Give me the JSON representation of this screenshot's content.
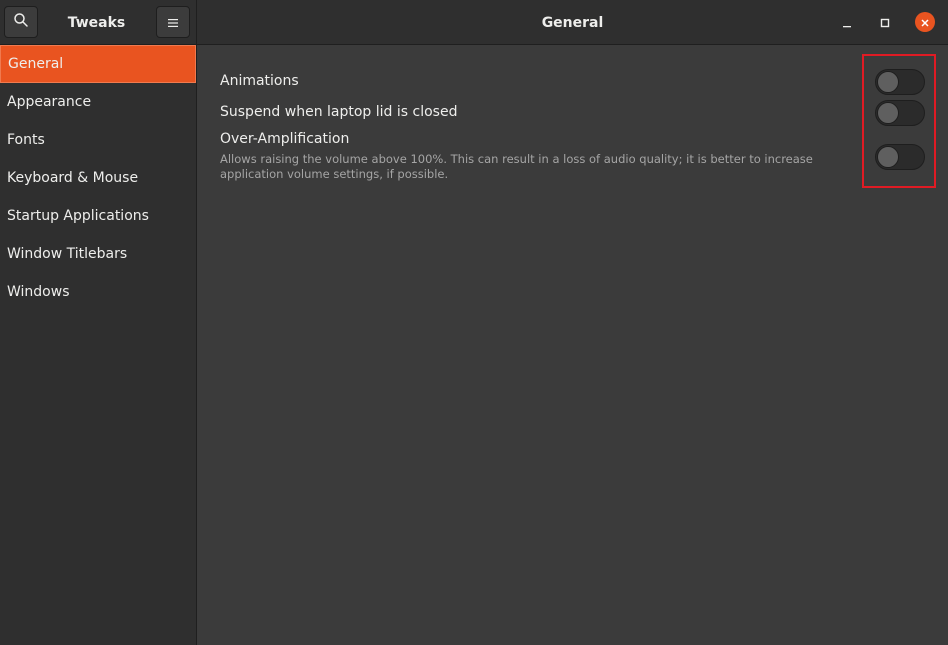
{
  "app": {
    "title": "Tweaks"
  },
  "header": {
    "page_title": "General"
  },
  "icons": {
    "search": "search-icon",
    "menu": "hamburger-menu-icon",
    "minimize": "minimize-icon",
    "maximize": "maximize-icon",
    "close": "close-icon"
  },
  "sidebar": {
    "items": [
      {
        "label": "General",
        "active": true
      },
      {
        "label": "Appearance"
      },
      {
        "label": "Fonts"
      },
      {
        "label": "Keyboard & Mouse"
      },
      {
        "label": "Startup Applications"
      },
      {
        "label": "Window Titlebars"
      },
      {
        "label": "Windows"
      }
    ]
  },
  "settings": {
    "animations": {
      "label": "Animations",
      "enabled": false
    },
    "suspend_lid": {
      "label": "Suspend when laptop lid is closed",
      "enabled": false
    },
    "over_amplification": {
      "label": "Over-Amplification",
      "description": "Allows raising the volume above 100%. This can result in a loss of audio quality; it is better to increase application volume settings, if possible.",
      "enabled": false
    }
  },
  "colors": {
    "accent": "#e95420",
    "highlight_box": "#e01b24",
    "background": "#3b3b3b",
    "sidebar": "#2f2f2f"
  }
}
